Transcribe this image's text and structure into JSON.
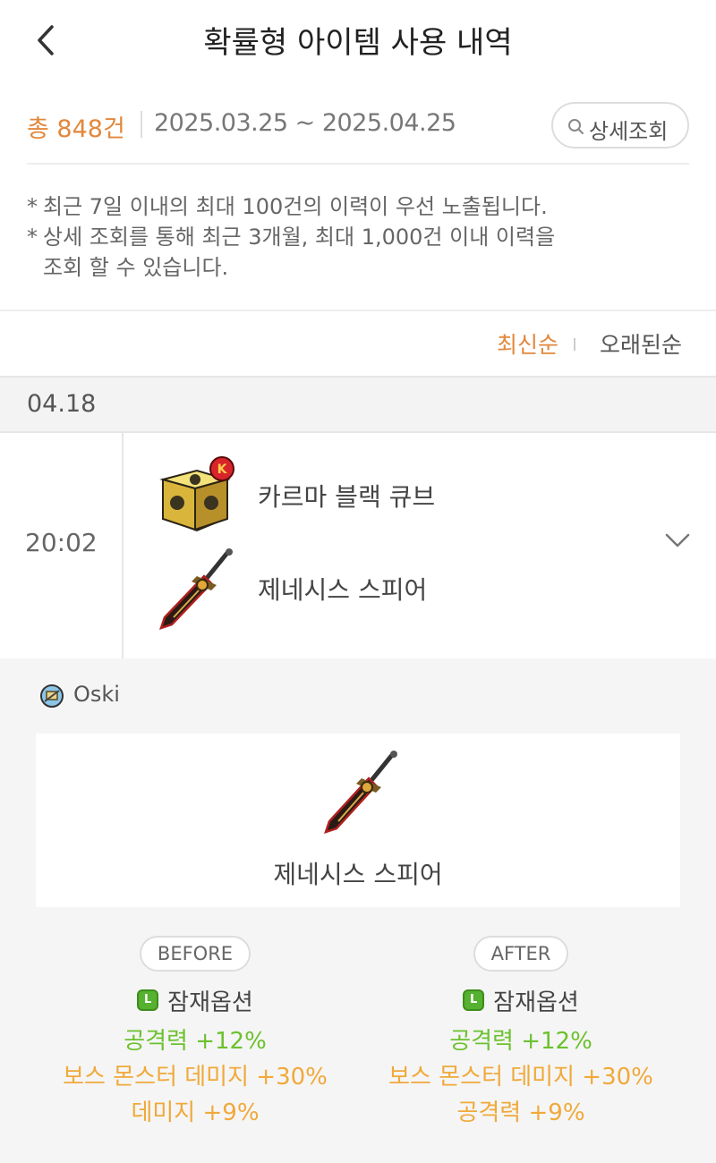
{
  "header": {
    "title": "확률형 아이템 사용 내역"
  },
  "summary": {
    "total": "총 848건",
    "period": "2025.03.25 ~ 2025.04.25",
    "detail_button": "상세조회"
  },
  "notes": [
    "최근 7일 이내의 최대 100건의 이력이 우선 노출됩니다.",
    "상세 조회를 통해 최근 3개월, 최대 1,000건 이내 이력을",
    "조회 할 수 있습니다."
  ],
  "sort": {
    "newest": "최신순",
    "oldest": "오래된순",
    "active": "최신순"
  },
  "date_group": "04.18",
  "record": {
    "time": "20:02",
    "used_item": "카르마 블랙 큐브",
    "target_item": "제네시스 스피어",
    "expand_icon": "chevron-down-icon"
  },
  "detail": {
    "character": "Oski",
    "item_name": "제네시스 스피어",
    "before": {
      "label": "BEFORE",
      "potential_grade": "L",
      "potential_label": "잠재옵션",
      "options": [
        {
          "text": "공격력 +12%",
          "color": "#6cc12e"
        },
        {
          "text": "보스 몬스터 데미지 +30%",
          "color": "#f0a93a"
        },
        {
          "text": "데미지 +9%",
          "color": "#f0a93a"
        }
      ]
    },
    "after": {
      "label": "AFTER",
      "potential_grade": "L",
      "potential_label": "잠재옵션",
      "options": [
        {
          "text": "공격력 +12%",
          "color": "#6cc12e"
        },
        {
          "text": "보스 몬스터 데미지 +30%",
          "color": "#f0a93a"
        },
        {
          "text": "공격력 +9%",
          "color": "#f0a93a"
        }
      ]
    }
  },
  "colors": {
    "accent": "#e2883c",
    "legendary": "#55b12f"
  }
}
